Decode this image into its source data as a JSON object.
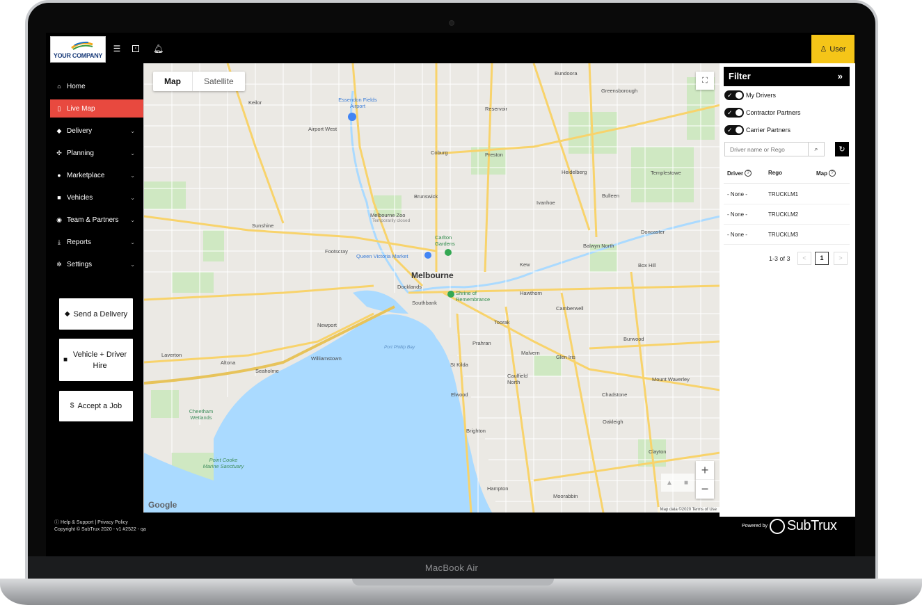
{
  "device": {
    "label": "MacBook Air"
  },
  "brand": {
    "logo_text": "YOUR COMPANY",
    "user_label": "User",
    "powered_by": "Powered by",
    "product": "SubTrux"
  },
  "sidebar": {
    "items": [
      {
        "label": "Home",
        "icon": "home-icon",
        "active": false
      },
      {
        "label": "Live Map",
        "icon": "map-icon",
        "active": true
      },
      {
        "label": "Delivery",
        "icon": "tag-icon",
        "active": false
      },
      {
        "label": "Planning",
        "icon": "sitemap-icon",
        "active": false
      },
      {
        "label": "Marketplace",
        "icon": "users-icon",
        "active": false
      },
      {
        "label": "Vehicles",
        "icon": "truck-icon",
        "active": false
      },
      {
        "label": "Team & Partners",
        "icon": "user-circle-icon",
        "active": false
      },
      {
        "label": "Reports",
        "icon": "download-icon",
        "active": false
      },
      {
        "label": "Settings",
        "icon": "gear-icon",
        "active": false
      }
    ],
    "cards": [
      {
        "label": "Send a Delivery"
      },
      {
        "label": "Vehicle + Driver Hire"
      },
      {
        "label": "Accept a Job"
      }
    ]
  },
  "footer": {
    "line1": "ⓘ Help & Support | Privacy Policy",
    "line2": "Copyright © SubTrux 2020 - v1 #2522 - qa"
  },
  "map": {
    "tabs": [
      "Map",
      "Satellite"
    ],
    "active_tab": "Map",
    "google": "Google",
    "attribution": "Map data ©2020   Terms of Use",
    "labels": {
      "melbourne": "Melbourne",
      "essendon": "Essendon Fields Airport",
      "qvm": "Queen Victoria Market",
      "shrine": "Shrine of Remembrance",
      "zoo": "Melbourne Zoo",
      "zoo_sub": "Temporarily closed",
      "carlton": "Carlton Gardens",
      "bay": "Port Phillip Bay",
      "docklands": "Docklands",
      "southbank": "Southbank",
      "st_kilda": "St Kilda",
      "brunswick": "Brunswick",
      "coburg": "Coburg",
      "preston": "Preston",
      "footscray": "Footscray",
      "sunshine": "Sunshine",
      "altona": "Altona",
      "williamstown": "Williamstown",
      "richmond": "Kew",
      "hawthorn": "Hawthorn",
      "camberwell": "Camberwell",
      "box_hill": "Box Hill",
      "doncaster": "Doncaster",
      "brighton": "Brighton",
      "caulfield": "Caulfield North",
      "elwood": "Elwood",
      "moorabbin": "Moorabbin",
      "oakleigh": "Oakleigh",
      "glen_iris": "Glen Iris",
      "keilor": "Keilor",
      "airport_west": "Airport West",
      "heidelberg": "Heidelberg",
      "greensborough": "Greensborough",
      "bundoora": "Bundoora",
      "reservoir": "Reservoir",
      "ivanhoe": "Ivanhoe",
      "bulleen": "Bulleen",
      "templestowe": "Templestowe",
      "werribee": "Laverton",
      "point_cooke": "Point Cooke Marine Sanctuary",
      "cheetham": "Cheetham Wetlands",
      "newport": "Newport",
      "seaholme": "Seaholme",
      "prahran": "Prahran",
      "toorak": "Toorak",
      "malvern": "Malvern",
      "chadstone": "Chadstone",
      "hampton": "Hampton",
      "glen_waverley": "Mount Waverley",
      "clayton": "Clayton",
      "burwood": "Burwood",
      "balwyn": "Balwyn North"
    }
  },
  "filter": {
    "title": "Filter",
    "toggles": [
      "My Drivers",
      "Contractor Partners",
      "Carrier Partners"
    ],
    "search_placeholder": "Driver name or Rego",
    "columns": {
      "driver": "Driver",
      "rego": "Rego",
      "map": "Map"
    },
    "rows": [
      {
        "driver": "- None -",
        "rego": "TRUCKLM1"
      },
      {
        "driver": "- None -",
        "rego": "TRUCKLM2"
      },
      {
        "driver": "- None -",
        "rego": "TRUCKLM3"
      }
    ],
    "pager": {
      "info": "1-3 of 3",
      "current": "1",
      "prev": "<",
      "next": ">"
    }
  },
  "colors": {
    "accent": "#e8493f",
    "user_button": "#f5c518",
    "water": "#aadaff",
    "road_major": "#f8d36b"
  }
}
